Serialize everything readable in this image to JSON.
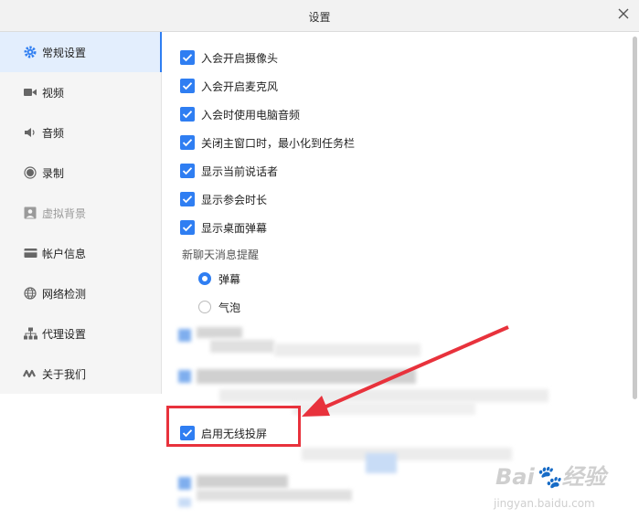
{
  "window": {
    "title": "设置"
  },
  "sidebar": {
    "items": [
      {
        "label": "常规设置",
        "icon": "gear-icon",
        "active": true,
        "disabled": false
      },
      {
        "label": "视频",
        "icon": "video-icon",
        "active": false,
        "disabled": false
      },
      {
        "label": "音频",
        "icon": "speaker-icon",
        "active": false,
        "disabled": false
      },
      {
        "label": "录制",
        "icon": "record-icon",
        "active": false,
        "disabled": false
      },
      {
        "label": "虚拟背景",
        "icon": "portrait-icon",
        "active": false,
        "disabled": true
      },
      {
        "label": "帐户信息",
        "icon": "card-icon",
        "active": false,
        "disabled": false
      },
      {
        "label": "网络检测",
        "icon": "globe-icon",
        "active": false,
        "disabled": false
      },
      {
        "label": "代理设置",
        "icon": "network-icon",
        "active": false,
        "disabled": false
      },
      {
        "label": "关于我们",
        "icon": "logo-icon",
        "active": false,
        "disabled": false
      }
    ]
  },
  "general": {
    "options": [
      {
        "label": "入会开启摄像头",
        "checked": true
      },
      {
        "label": "入会开启麦克风",
        "checked": true
      },
      {
        "label": "入会时使用电脑音频",
        "checked": true
      },
      {
        "label": "关闭主窗口时，最小化到任务栏",
        "checked": true
      },
      {
        "label": "显示当前说话者",
        "checked": true
      },
      {
        "label": "显示参会时长",
        "checked": true
      },
      {
        "label": "显示桌面弹幕",
        "checked": true
      }
    ],
    "chat_section_label": "新聊天消息提醒",
    "chat_options": [
      {
        "label": "弹幕",
        "selected": true
      },
      {
        "label": "气泡",
        "selected": false
      }
    ],
    "wireless_projection": {
      "label": "启用无线投屏",
      "checked": true
    }
  },
  "colors": {
    "accent": "#2f7ef2",
    "annotation": "#e8323c"
  },
  "watermark": {
    "main": "Bai🐾经验",
    "sub": "jingyan.baidu.com"
  }
}
